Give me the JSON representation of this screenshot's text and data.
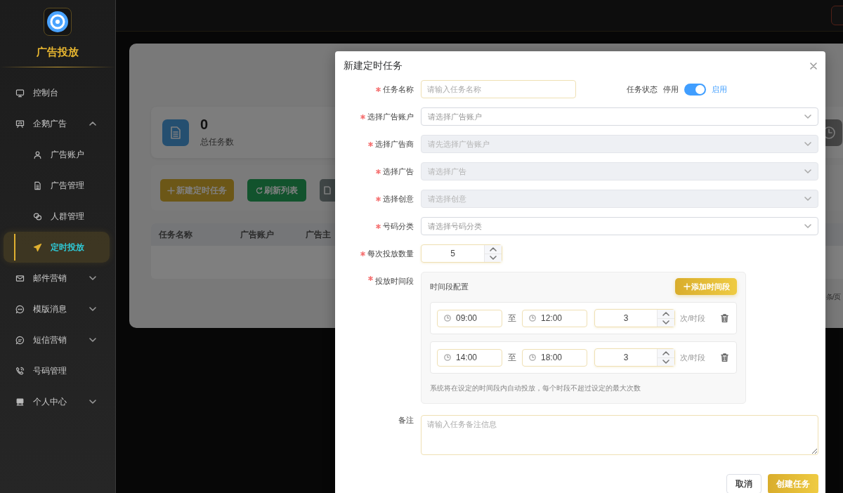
{
  "sidebar": {
    "title": "广告投放",
    "items": [
      {
        "label": "控制台",
        "selected": false
      },
      {
        "label": "企鹅广告",
        "selected": false,
        "expanded": true,
        "children": [
          {
            "label": "广告账户",
            "selected": false
          },
          {
            "label": "广告管理",
            "selected": false
          },
          {
            "label": "人群管理",
            "selected": false
          },
          {
            "label": "定时投放",
            "selected": true
          }
        ]
      },
      {
        "label": "邮件营销",
        "selected": false,
        "expanded": false
      },
      {
        "label": "模版消息",
        "selected": false,
        "expanded": false
      },
      {
        "label": "短信营销",
        "selected": false,
        "expanded": false
      },
      {
        "label": "号码管理",
        "selected": false
      },
      {
        "label": "个人中心",
        "selected": false,
        "expanded": false
      }
    ]
  },
  "page": {
    "stat": {
      "value": "0",
      "label": "总任务数"
    },
    "toolbar": [
      {
        "label": "新建定时任务",
        "kind": "add"
      },
      {
        "label": "刷新列表",
        "kind": "refresh"
      },
      {
        "kind": "more"
      }
    ],
    "table": {
      "columns": [
        "任务名称",
        "广告账户",
        "广告主"
      ]
    },
    "pagination": "条/页"
  },
  "dialog": {
    "title": "新建定时任务",
    "name_field": {
      "label": "任务名称",
      "required": true,
      "placeholder": "请输入任务名称"
    },
    "status": {
      "label": "任务状态",
      "off_label": "停用",
      "on_label": "启用",
      "on": true
    },
    "selects": [
      {
        "label": "选择广告账户",
        "required": true,
        "placeholder": "请选择广告账户",
        "disabled": false
      },
      {
        "label": "选择广告商",
        "required": true,
        "placeholder": "请先选择广告账户",
        "disabled": true
      },
      {
        "label": "选择广告",
        "required": true,
        "placeholder": "请选择广告",
        "disabled": true
      },
      {
        "label": "选择创意",
        "required": true,
        "placeholder": "请选择创意",
        "disabled": true
      },
      {
        "label": "号码分类",
        "required": true,
        "placeholder": "请选择号码分类",
        "disabled": false
      }
    ],
    "quantity": {
      "label": "每次投放数量",
      "required": true,
      "value": "5"
    },
    "schedule": {
      "label": "投放时间段",
      "required": true,
      "title": "时间段配置",
      "add_button": "添加时间段",
      "slots": [
        {
          "start": "09:00",
          "separator": "至",
          "end": "12:00",
          "count": "3",
          "unit": "次/时段"
        },
        {
          "start": "14:00",
          "separator": "至",
          "end": "18:00",
          "count": "3",
          "unit": "次/时段"
        }
      ],
      "hint": "系统将在设定的时间段内自动投放，每个时段不超过设定的最大次数"
    },
    "notes": {
      "label": "备注",
      "required": false,
      "placeholder": "请输入任务备注信息"
    },
    "buttons": [
      {
        "label": "取消",
        "kind": "secondary"
      },
      {
        "label": "创建任务",
        "kind": "primary"
      }
    ]
  }
}
